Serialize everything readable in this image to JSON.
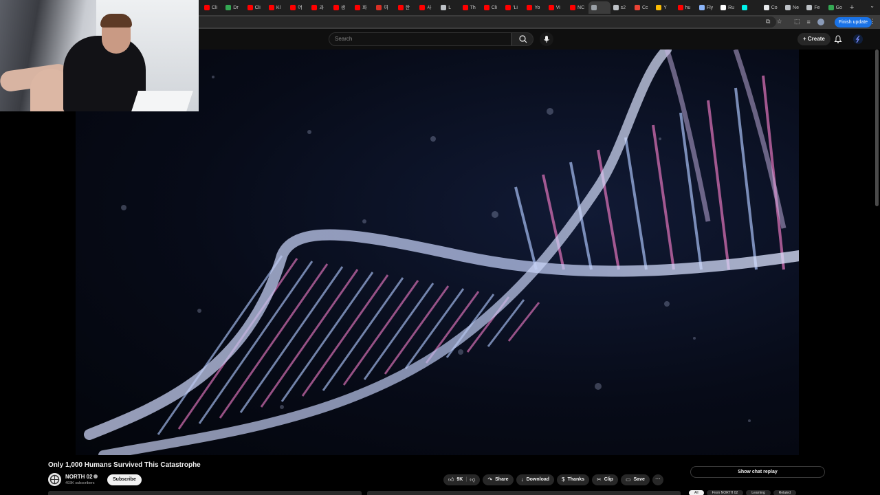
{
  "browser": {
    "tabs": [
      {
        "label": "Cli",
        "color": "#ff0000"
      },
      {
        "label": "Dr",
        "color": "#34a853"
      },
      {
        "label": "Cli",
        "color": "#ff0000"
      },
      {
        "label": "Kl",
        "color": "#ff0000"
      },
      {
        "label": "어",
        "color": "#ff0000"
      },
      {
        "label": "과",
        "color": "#ff0000"
      },
      {
        "label": "생",
        "color": "#ff0000"
      },
      {
        "label": "화",
        "color": "#ff0000"
      },
      {
        "label": "여",
        "color": "#d93025"
      },
      {
        "label": "한",
        "color": "#ff0000"
      },
      {
        "label": "사",
        "color": "#ff0000"
      },
      {
        "label": "L",
        "color": "#bdc1c6"
      },
      {
        "label": "Th",
        "color": "#ff0000"
      },
      {
        "label": "Cli",
        "color": "#ff0000"
      },
      {
        "label": "'Li",
        "color": "#ff0000"
      },
      {
        "label": "Yo",
        "color": "#ff0000"
      },
      {
        "label": "Vi",
        "color": "#ff0000"
      },
      {
        "label": "NC",
        "color": "#ff0000"
      },
      {
        "label": "",
        "color": "#9aa0a6",
        "active": true
      },
      {
        "label": "s2",
        "color": "#bdc1c6"
      },
      {
        "label": "Cc",
        "color": "#ea4335"
      },
      {
        "label": "Y",
        "color": "#fbbc04"
      },
      {
        "label": "hu",
        "color": "#ff0000"
      },
      {
        "label": "Fly",
        "color": "#8ab4f8"
      },
      {
        "label": "Ru",
        "color": "#ffffff"
      },
      {
        "label": "",
        "color": "#00f2ea"
      },
      {
        "label": "Co",
        "color": "#e8eaed"
      },
      {
        "label": "Ne",
        "color": "#bdc1c6"
      },
      {
        "label": "Fe",
        "color": "#bdc1c6"
      },
      {
        "label": "Go",
        "color": "#34a853"
      }
    ],
    "new_tab": "+",
    "finish_update": "Finish update"
  },
  "header": {
    "search_placeholder": "Search",
    "create_label": "Create"
  },
  "video": {
    "title": "Only 1,000 Humans Survived This Catastrophe",
    "channel_name": "NORTH 02",
    "subscribers": "493K subscribers",
    "subscribe_label": "Subscribe",
    "likes": "9K",
    "share_label": "Share",
    "download_label": "Download",
    "thanks_label": "Thanks",
    "clip_label": "Clip",
    "save_label": "Save"
  },
  "chat": {
    "show_replay": "Show chat replay"
  },
  "chips": [
    "All",
    "From NORTH 02",
    "Learning",
    "Related"
  ],
  "colors": {
    "accent": "#1a73e8",
    "background": "#0f0f0f",
    "pill": "#272727",
    "dna_pink": "#d46fb3",
    "dna_blue": "#9fb6e8"
  }
}
